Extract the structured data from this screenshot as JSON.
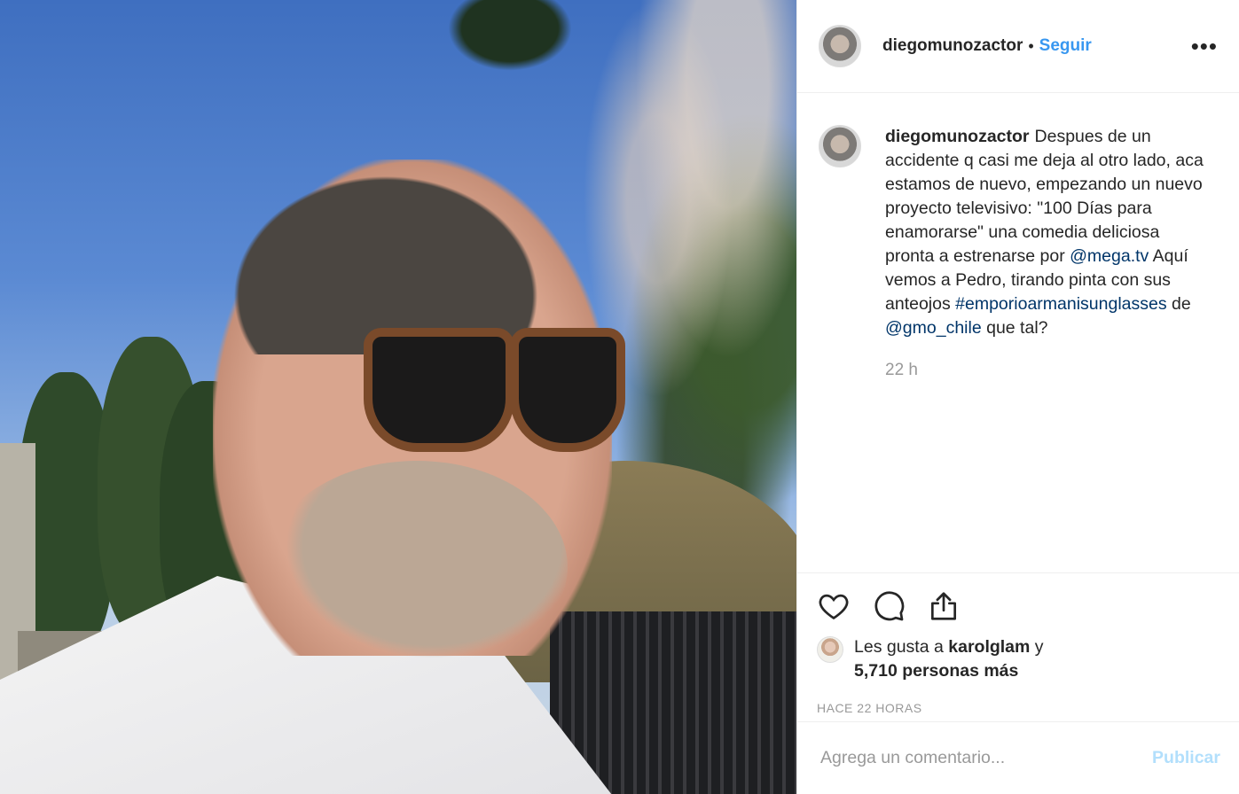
{
  "post": {
    "username": "diegomunozactor",
    "follow_separator": "•",
    "follow_label": "Seguir",
    "more_icon": "more-icon",
    "caption_intro": "Despues de un accidente q casi me deja al otro lado, aca estamos de nuevo, empezando un nuevo proyecto televisivo: \"100 Días para enamorarse\" una comedia deliciosa pronta a estrenarse por",
    "mention_1": "@mega.tv",
    "caption_mid": "Aquí vemos a Pedro, tirando pinta con sus anteojos",
    "hashtag": "#emporioarmanisunglasses",
    "caption_de": "de",
    "mention_2": "@gmo_chile",
    "caption_end": "que tal?",
    "comment_time": "22 h"
  },
  "actions": {
    "like_icon": "heart-icon",
    "comment_icon": "comment-icon",
    "share_icon": "share-icon"
  },
  "likes": {
    "prefix": "Les gusta a",
    "liker": "karolglam",
    "conj": "y",
    "others": "5,710 personas más"
  },
  "posted_ago": "HACE 22 HORAS",
  "comment_box": {
    "placeholder": "Agrega un comentario...",
    "publish_label": "Publicar"
  },
  "colors": {
    "link": "#003569",
    "follow": "#3897f0",
    "publish_disabled": "#b2dffc",
    "muted": "#999999"
  }
}
